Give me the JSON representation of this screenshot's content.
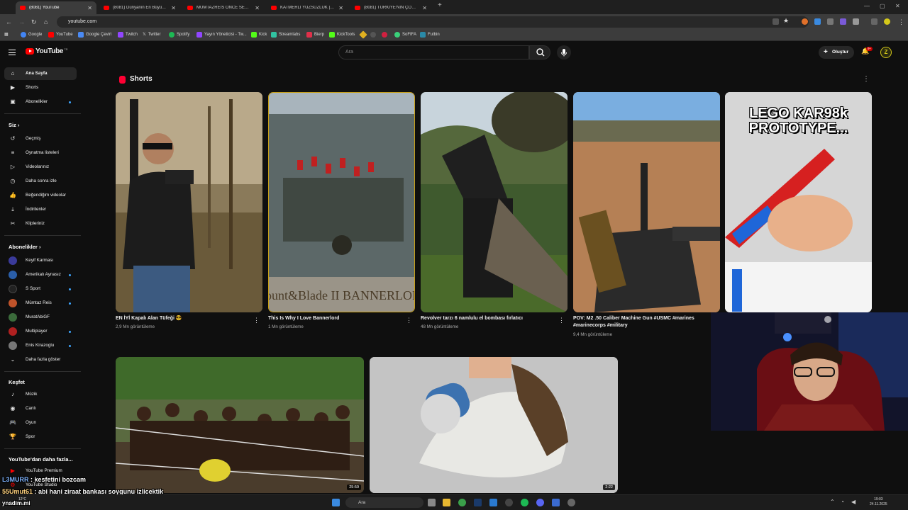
{
  "browser": {
    "tabs": [
      {
        "label": "(8081) YouTube",
        "active": true
      },
      {
        "label": "(8081) Dünyanın En Büyük 'Yer...",
        "active": false
      },
      {
        "label": "MÜMTAZREİS ÖNCE SEVİNDİ S...",
        "active": false
      },
      {
        "label": "KATMERLİ YÜZSÜZLÜK | Stride...",
        "active": false
      },
      {
        "label": "(8081) TÜRKİYE'NİN ÇÖZÜLEMİ...",
        "active": false
      }
    ],
    "new_tab": "+",
    "url": "youtube.com",
    "bookmarks": [
      "Google",
      "YouTube",
      "Google Çeviri",
      "Twitch",
      "Twitter",
      "Spotify",
      "Yayın Yöneticisi - Tw...",
      "Kick",
      "Streamlabs",
      "Bierp",
      "KickTools",
      "SoFIFA",
      "Futbin"
    ]
  },
  "youtube": {
    "logo": "YouTube",
    "logo_country": "TR",
    "search_placeholder": "Ara",
    "create_label": "Oluştur",
    "notifications": "9+",
    "avatar_letter": "Z"
  },
  "sidebar": {
    "main": [
      {
        "label": "Ana Sayfa",
        "icon": "home-icon",
        "active": true
      },
      {
        "label": "Shorts",
        "icon": "shorts-icon"
      },
      {
        "label": "Abonelikler",
        "icon": "subscriptions-icon",
        "dot": true
      }
    ],
    "you_heading": "Siz",
    "you": [
      {
        "label": "Geçmiş",
        "icon": "history-icon"
      },
      {
        "label": "Oynatma listeleri",
        "icon": "playlist-icon"
      },
      {
        "label": "Videolarınız",
        "icon": "your-videos-icon"
      },
      {
        "label": "Daha sonra izle",
        "icon": "watch-later-icon"
      },
      {
        "label": "Beğendiğim videolar",
        "icon": "liked-icon"
      },
      {
        "label": "İndirilenler",
        "icon": "download-icon"
      },
      {
        "label": "Klipleriniz",
        "icon": "clips-icon"
      }
    ],
    "subs_heading": "Abonelikler",
    "subs": [
      {
        "label": "Keyif Karması",
        "color": "#3a3a9a"
      },
      {
        "label": "Amerikalı Aynasız",
        "color": "#2a5ea8",
        "dot": true
      },
      {
        "label": "S Sport",
        "color": "#222222",
        "dot": true
      },
      {
        "label": "Mümtaz Reis",
        "color": "#c0532a",
        "dot": true
      },
      {
        "label": "MuratAbiGF",
        "color": "#3b6b3b"
      },
      {
        "label": "Multiplayer",
        "color": "#b02020",
        "dot": true
      },
      {
        "label": "Enis Kirazoglu",
        "color": "#777777",
        "dot": true
      }
    ],
    "show_more": "Daha fazla göster",
    "explore_heading": "Keşfet",
    "explore": [
      {
        "label": "Müzik",
        "icon": "music-icon"
      },
      {
        "label": "Canlı",
        "icon": "live-icon"
      },
      {
        "label": "Oyun",
        "icon": "gaming-icon"
      },
      {
        "label": "Spor",
        "icon": "sports-icon"
      }
    ],
    "more_heading": "YouTube'dan daha fazla...",
    "more": [
      {
        "label": "YouTube Premium"
      },
      {
        "label": "YouTube Studio"
      }
    ]
  },
  "shorts": {
    "heading": "Shorts",
    "items": [
      {
        "title": "EN İYİ Kapalı Alan Tüfeği 😎",
        "views": "2,9 Mn görüntüleme"
      },
      {
        "title": "This Is Why I Love Bannerlord",
        "views": "1 Mn görüntüleme"
      },
      {
        "title": "Revolver tarzı 6 namlulu el bombası fırlatıcı",
        "views": "48 Mn görüntüleme"
      },
      {
        "title": "POV: M2 .50 Caliber Machine Gun #USMC #marines #marinecorps #military",
        "views": "9,4 Mn görüntüleme"
      },
      {
        "title": "",
        "views": "",
        "overlay_text": "LEGO KAR98k PROTOTYPE..."
      }
    ]
  },
  "thumb_texts": {
    "bannerlord": "Mount&Blade II BANNERLORD"
  },
  "videos": [
    {
      "duration": "25:59"
    },
    {
      "duration": "2:22"
    }
  ],
  "chat": [
    {
      "user": "L3MURR",
      "text": " : kesfetini bozcam"
    },
    {
      "user": "55Umut61",
      "text": " : abi hani ziraat bankası soygunu izlicektik"
    },
    {
      "user": "ynadim.mi",
      "text": ""
    }
  ],
  "taskbar": {
    "search": "Ara",
    "weather_temp": "12°C",
    "weather_text": "Bulutlu",
    "time": "19:03",
    "date": "24.11.2025"
  }
}
